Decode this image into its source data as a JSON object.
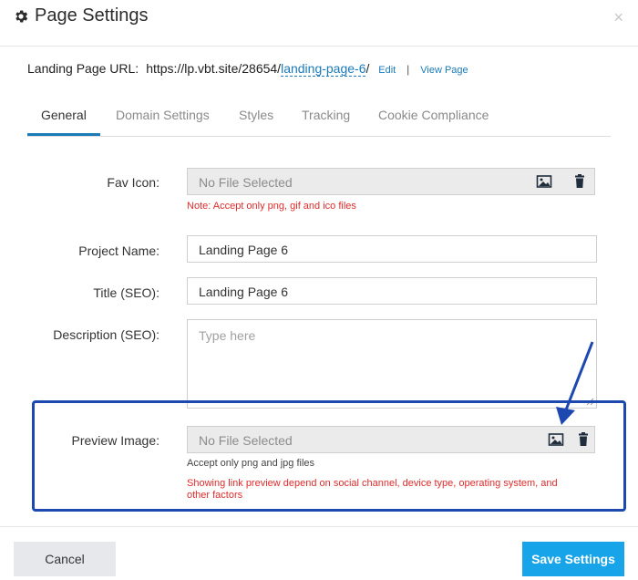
{
  "dialog": {
    "title": "Page Settings",
    "close_label": "×"
  },
  "url": {
    "label": "Landing Page URL:",
    "base": "https://lp.vbt.site/28654/",
    "slug": "landing-page-6",
    "trail": "/",
    "edit_label": "Edit",
    "separator": "|",
    "view_label": "View Page"
  },
  "tabs": [
    {
      "label": "General",
      "active": true
    },
    {
      "label": "Domain Settings",
      "active": false
    },
    {
      "label": "Styles",
      "active": false
    },
    {
      "label": "Tracking",
      "active": false
    },
    {
      "label": "Cookie Compliance",
      "active": false
    }
  ],
  "form": {
    "fav_icon": {
      "label": "Fav Icon:",
      "placeholder": "No File Selected",
      "note": "Note: Accept only png, gif and ico files"
    },
    "project_name": {
      "label": "Project Name:",
      "value": "Landing Page 6"
    },
    "title_seo": {
      "label": "Title (SEO):",
      "value": "Landing Page 6"
    },
    "description_seo": {
      "label": "Description (SEO):",
      "placeholder": "Type here"
    },
    "preview_image": {
      "label": "Preview Image:",
      "placeholder": "No File Selected",
      "note_accept": "Accept only png and jpg files",
      "note_preview_line1": "Showing link preview depend on social channel, device type, operating system, and",
      "note_preview_line2": "other factors"
    }
  },
  "footer": {
    "cancel_label": "Cancel",
    "save_label": "Save Settings"
  },
  "colors": {
    "accent": "#1a7bb8",
    "save_button": "#17a4e8",
    "note_red": "#e12b2b",
    "highlight": "#1c48b0"
  },
  "icons": [
    "gear-icon",
    "close-icon",
    "image-icon",
    "trash-icon",
    "arrow-icon"
  ]
}
